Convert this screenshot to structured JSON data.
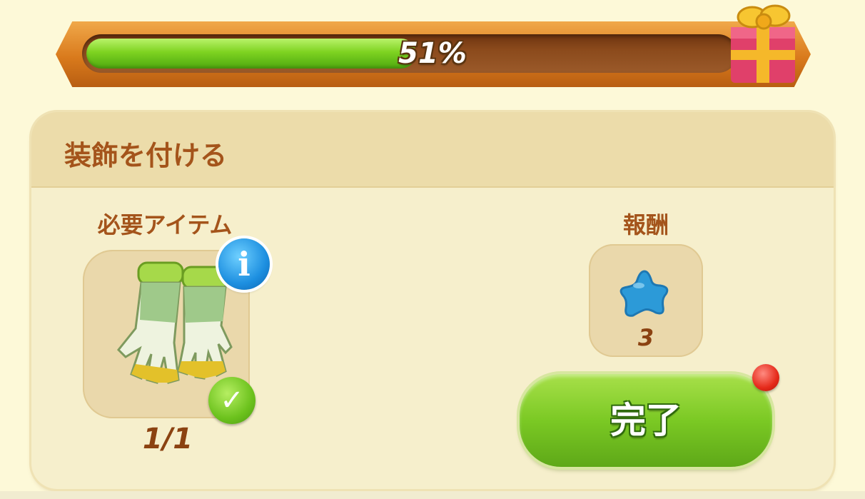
{
  "progress": {
    "label": "51%",
    "value": 0.51
  },
  "panel": {
    "title": "装飾を付ける",
    "required_label": "必要アイテム",
    "reward_label": "報酬",
    "required_item": {
      "icon": "gloves-icon",
      "count": "1/1",
      "info": "i"
    },
    "reward": {
      "icon": "blue-star-icon",
      "count": "3"
    },
    "complete_button": "完了"
  },
  "colors": {
    "brown_text": "#a4541b",
    "green_button": "#7bc924",
    "progress_green": "#7ed321",
    "panel_bg": "#f6efcc"
  }
}
